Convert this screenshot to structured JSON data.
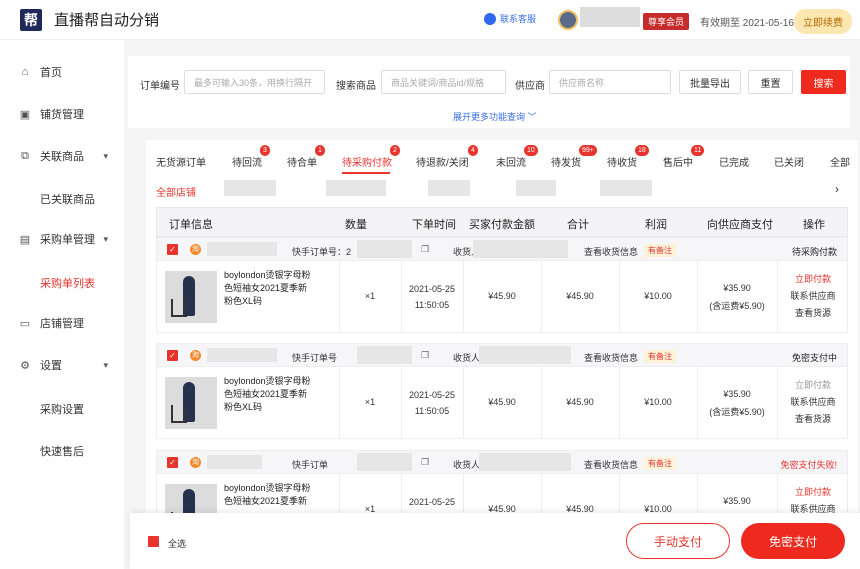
{
  "app": {
    "logo_char": "帮",
    "title": "直播帮自动分销"
  },
  "header": {
    "support_label": "联系客服",
    "vip_label": "尊享会员",
    "expire_text": "有效期至 2021-05-16",
    "renew_label": "立即续费"
  },
  "sidebar": {
    "items": [
      {
        "label": "首页",
        "icon": "home-icon"
      },
      {
        "label": "铺货管理",
        "icon": "box-icon"
      },
      {
        "label": "关联商品",
        "icon": "link-icon"
      },
      {
        "label": "已关联商品"
      },
      {
        "label": "采购单管理",
        "icon": "list-icon"
      },
      {
        "label": "采购单列表"
      },
      {
        "label": "店铺管理",
        "icon": "shop-icon"
      },
      {
        "label": "设置",
        "icon": "gear-icon"
      },
      {
        "label": "采购设置"
      },
      {
        "label": "快速售后"
      }
    ]
  },
  "filter": {
    "order_no_label": "订单编号",
    "order_no_placeholder": "最多可输入30条，用换行隔开",
    "goods_label": "搜索商品",
    "goods_placeholder": "商品关键词/商品id/规格",
    "supplier_label": "供应商",
    "supplier_placeholder": "供应商名称",
    "export_label": "批量导出",
    "reset_label": "重置",
    "search_label": "搜索",
    "expand_label": "展开更多功能查询"
  },
  "tabs": [
    {
      "label": "无货源订单",
      "badge": ""
    },
    {
      "label": "待回流",
      "badge": "3"
    },
    {
      "label": "待合单",
      "badge": "1"
    },
    {
      "label": "待采购付款",
      "badge": "2"
    },
    {
      "label": "待退款/关闭",
      "badge": "4"
    },
    {
      "label": "未回流",
      "badge": "10"
    },
    {
      "label": "待发货",
      "badge": "99+"
    },
    {
      "label": "待收货",
      "badge": "18"
    },
    {
      "label": "售后中",
      "badge": "11"
    },
    {
      "label": "已完成",
      "badge": ""
    },
    {
      "label": "已关闭",
      "badge": ""
    },
    {
      "label": "全部",
      "badge": ""
    }
  ],
  "all_shops": "全部店铺",
  "table": {
    "headers": [
      "订单信息",
      "数量",
      "下单时间",
      "买家付款金额",
      "合计",
      "利润",
      "向供应商支付",
      "操作"
    ]
  },
  "orders": [
    {
      "shop_badge": "淘",
      "quick_order": "快手订单号：2",
      "receiver": "收货人",
      "view_receiver": "查看收货信息",
      "note": "有备注",
      "status": "待采购付款",
      "product": "boylondon烫银字母粉色短袖女2021夏季新粉色XL码",
      "qty": "×1",
      "date": "2021-05-25",
      "time": "11:50:05",
      "buyer_pay": "¥45.90",
      "total": "¥45.90",
      "profit": "¥10.00",
      "supplier_pay": "¥35.90",
      "freight": "(含运费¥5.90)",
      "ops": [
        "立即付款",
        "联系供应商",
        "查看货源"
      ]
    },
    {
      "shop_badge": "淘",
      "quick_order": "快手订单号",
      "receiver": "收货人：",
      "view_receiver": "查看收货信息",
      "note": "有备注",
      "status": "免密支付中",
      "product": "boylondon烫银字母粉色短袖女2021夏季新粉色XL码",
      "qty": "×1",
      "date": "2021-05-25",
      "time": "11:50:05",
      "buyer_pay": "¥45.90",
      "total": "¥45.90",
      "profit": "¥10.00",
      "supplier_pay": "¥35.90",
      "freight": "(含运费¥5.90)",
      "ops": [
        "立即付款",
        "联系供应商",
        "查看货源"
      ]
    },
    {
      "shop_badge": "淘",
      "quick_order": "快手订单",
      "receiver": "收货人",
      "view_receiver": "查看收货信息",
      "note": "有备注",
      "status": "免密支付失败!",
      "product": "boylondon烫银字母粉色短袖女2021夏季新",
      "qty": "×1",
      "date": "2021-05-25",
      "buyer_pay": "¥45.90",
      "total": "¥45.90",
      "profit": "¥10.00",
      "supplier_pay": "¥35.90",
      "ops": [
        "立即付款",
        "联系供应商"
      ]
    }
  ],
  "bottom": {
    "select_all": "全选",
    "manual_pay": "手动支付",
    "free_pay": "免密支付"
  },
  "colors": {
    "accent": "#e8342d",
    "link": "#3a6ee8",
    "vip": "#c62c2c"
  }
}
